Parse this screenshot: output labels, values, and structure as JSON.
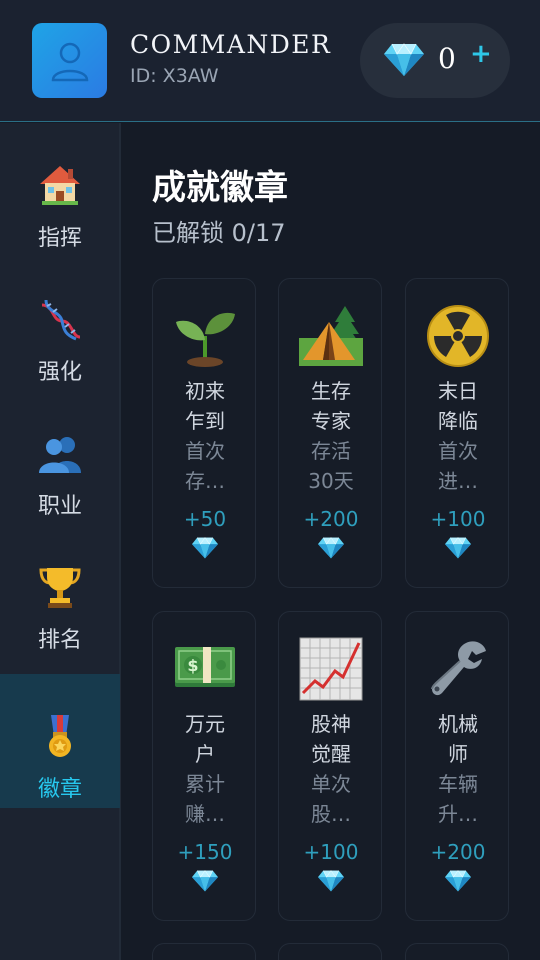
{
  "header": {
    "user_name": "COMMANDER",
    "user_id": "ID: X3AW",
    "gem_count": "0",
    "gem_add": "+"
  },
  "sidebar": {
    "items": [
      {
        "label": "指挥",
        "icon": "house-icon",
        "active": false
      },
      {
        "label": "强化",
        "icon": "dna-icon",
        "active": false
      },
      {
        "label": "职业",
        "icon": "people-icon",
        "active": false
      },
      {
        "label": "排名",
        "icon": "trophy-icon",
        "active": false
      },
      {
        "label": "徽章",
        "icon": "medal-icon",
        "active": true
      }
    ]
  },
  "main": {
    "title": "成就徽章",
    "unlock_status": "已解锁 0/17",
    "badges": [
      {
        "name_line1": "初来",
        "name_line2": "乍到",
        "desc_line1": "首次",
        "desc_line2": "存…",
        "reward": "+50",
        "icon": "seedling-icon"
      },
      {
        "name_line1": "生存",
        "name_line2": "专家",
        "desc_line1": "存活",
        "desc_line2": "30天",
        "reward": "+200",
        "icon": "camping-icon"
      },
      {
        "name_line1": "末日",
        "name_line2": "降临",
        "desc_line1": "首次",
        "desc_line2": "进…",
        "reward": "+100",
        "icon": "radioactive-icon"
      },
      {
        "name_line1": "万元",
        "name_line2": "户",
        "desc_line1": "累计",
        "desc_line2": "赚…",
        "reward": "+150",
        "icon": "money-icon"
      },
      {
        "name_line1": "股神",
        "name_line2": "觉醒",
        "desc_line1": "单次",
        "desc_line2": "股…",
        "reward": "+100",
        "icon": "chart-up-icon"
      },
      {
        "name_line1": "机械",
        "name_line2": "师",
        "desc_line1": "车辆",
        "desc_line2": "升…",
        "reward": "+200",
        "icon": "wrench-icon"
      }
    ]
  },
  "colors": {
    "accent": "#27c8ee",
    "background": "#151b26",
    "active_nav": "#173a4d",
    "reward": "#2f9fbd"
  }
}
